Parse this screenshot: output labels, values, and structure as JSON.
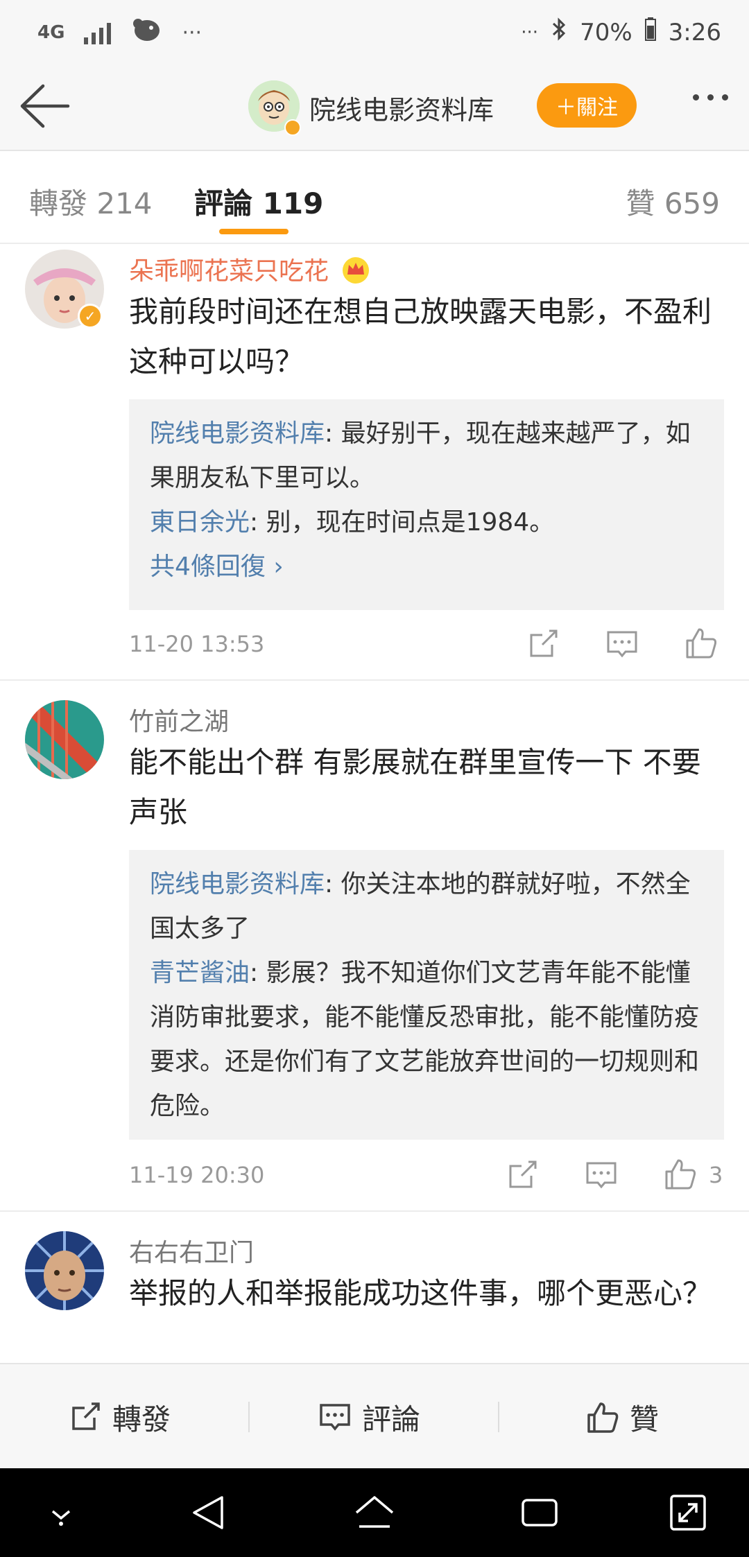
{
  "status_bar": {
    "network": "4G",
    "more_left": "···",
    "more_right": "···",
    "battery": "70%",
    "time": "3:26"
  },
  "header": {
    "title": "院线电影资料库",
    "follow_label": "＋關注"
  },
  "tabs": [
    {
      "label": "轉發 214"
    },
    {
      "label": "評論 119"
    },
    {
      "label": "贊 659"
    }
  ],
  "comments": [
    {
      "username": "朵乖啊花菜只吃花",
      "text": "我前段时间还在想自己放映露天电影，不盈利这种可以吗？",
      "replies": [
        {
          "name": "院线电影资料库",
          "text": ": 最好别干，现在越来越严了，如果朋友私下里可以。"
        },
        {
          "name": "東日余光",
          "text": ": 别，现在时间点是1984。"
        }
      ],
      "more_replies": "共4條回復 ›",
      "time": "11-20 13:53",
      "likes": ""
    },
    {
      "username": "竹前之湖",
      "text": "能不能出个群 有影展就在群里宣传一下 不要声张",
      "replies": [
        {
          "name": "院线电影资料库",
          "text": ": 你关注本地的群就好啦，不然全国太多了"
        },
        {
          "name": "青芒酱油",
          "text": ": 影展？我不知道你们文艺青年能不能懂消防审批要求，能不能懂反恐审批，能不能懂防疫要求。还是你们有了文艺能放弃世间的一切规则和危险。"
        }
      ],
      "time": "11-19 20:30",
      "likes": "3"
    },
    {
      "username": "右右右卫门",
      "text": "举报的人和举报能成功这件事，哪个更恶心？"
    }
  ],
  "bottom_bar": {
    "repost": "轉發",
    "comment": "評論",
    "like": "贊"
  },
  "colors": {
    "accent": "#fb9a10",
    "link": "#527fad",
    "vip_name": "#eb7350"
  }
}
